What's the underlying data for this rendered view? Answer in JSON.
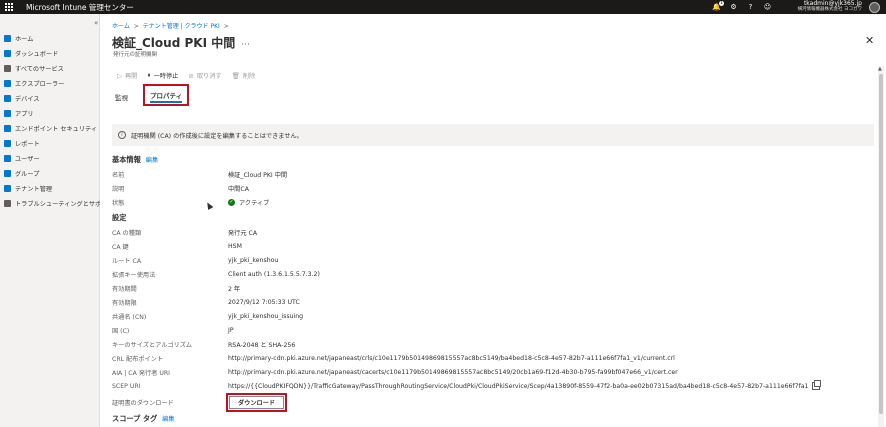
{
  "topbar": {
    "app_title": "Microsoft Intune 管理センター",
    "notification_count": "1",
    "user_email": "tkadmin@yjk365.jp",
    "user_org": "横河情報機器株式会社 ヨコガワ"
  },
  "sidebar": {
    "collapse": "«",
    "items": [
      {
        "label": "ホーム",
        "icon": "home-icon",
        "color": "#0078d4"
      },
      {
        "label": "ダッシュボード",
        "icon": "dashboard-icon",
        "color": "#0078d4"
      },
      {
        "label": "すべてのサービス",
        "icon": "services-icon",
        "color": "#605e5c"
      },
      {
        "label": "エクスプローラー",
        "icon": "explorer-icon",
        "color": "#0078d4"
      },
      {
        "label": "デバイス",
        "icon": "devices-icon",
        "color": "#0078d4"
      },
      {
        "label": "アプリ",
        "icon": "apps-icon",
        "color": "#0078d4"
      },
      {
        "label": "エンドポイント セキュリティ",
        "icon": "shield-icon",
        "color": "#0078d4"
      },
      {
        "label": "レポート",
        "icon": "reports-icon",
        "color": "#0078d4"
      },
      {
        "label": "ユーザー",
        "icon": "user-icon",
        "color": "#0078d4"
      },
      {
        "label": "グループ",
        "icon": "group-icon",
        "color": "#0078d4"
      },
      {
        "label": "テナント管理",
        "icon": "tenant-icon",
        "color": "#0078d4"
      },
      {
        "label": "トラブルシューティングとサポート",
        "icon": "wrench-icon",
        "color": "#605e5c"
      }
    ]
  },
  "breadcrumb": {
    "home": "ホーム",
    "tenant": "テナント管理 | クラウド PKI",
    "sep": ">"
  },
  "page": {
    "title": "検証_Cloud PKI 中間",
    "more": "···",
    "subtitle": "発行元の証明機関",
    "close": "✕"
  },
  "commands": {
    "resume": "再開",
    "pause": "一時停止",
    "revoke": "取り消す",
    "delete": "削除"
  },
  "tabs": {
    "monitor": "監視",
    "properties": "プロパティ"
  },
  "info": {
    "icon": "i",
    "message": "証明機関 (CA) の作成後に設定を編集することはできません。"
  },
  "basics": {
    "header": "基本情報",
    "edit": "編集",
    "rows": [
      {
        "label": "名前",
        "value": "検証_Cloud PKI 中間"
      },
      {
        "label": "説明",
        "value": "中間CA"
      },
      {
        "label": "状態",
        "value": "アクティブ"
      }
    ]
  },
  "settings": {
    "header": "設定",
    "rows": [
      {
        "label": "CA の種類",
        "value": "発行元 CA"
      },
      {
        "label": "CA 鍵",
        "value": "HSM"
      },
      {
        "label": "ルート CA",
        "value": "yjk_pki_kenshou"
      },
      {
        "label": "拡張キー使用法",
        "value": "Client auth (1.3.6.1.5.5.7.3.2)"
      },
      {
        "label": "有効期間",
        "value": "2 年"
      },
      {
        "label": "有効期限",
        "value": "2027/9/12 7:05:33 UTC"
      },
      {
        "label": "共通名 (CN)",
        "value": "yjk_pki_kenshou_issuing"
      },
      {
        "label": "国 (C)",
        "value": "JP"
      },
      {
        "label": "キーのサイズとアルゴリズム",
        "value": "RSA-2048 と SHA-256"
      },
      {
        "label": "CRL 配布ポイント",
        "value": "http://primary-cdn.pki.azure.net/japaneast/crls/c10e1179b50149869815557ac8bc5149/ba4bed18-c5c8-4e57-82b7-a111e66f7fa1_v1/current.crl"
      },
      {
        "label": "AIA | CA 発行者 URI",
        "value": "http://primary-cdn.pki.azure.net/japaneast/cacerts/c10e1179b50149869815557ac8bc5149/20cb1a69-f12d-4b30-b795-fa99bf047e66_v1/cert.cer"
      },
      {
        "label": "SCEP URI",
        "value": "https://{{CloudPKIFQDN}}/TrafficGateway/PassThroughRoutingService/CloudPki/CloudPkiService/Scep/4a13890f-8559-47f2-ba0a-ee02b07315ad/ba4bed18-c5c8-4e57-82b7-a111e66f7fa1"
      },
      {
        "label": "証明書のダウンロード",
        "value": ""
      }
    ],
    "download_label": "ダウンロード"
  },
  "scope": {
    "header": "スコープ タグ",
    "edit": "編集"
  },
  "colors": {
    "accent": "#0078d4",
    "highlight": "#c50f1f",
    "success": "#107c10"
  }
}
